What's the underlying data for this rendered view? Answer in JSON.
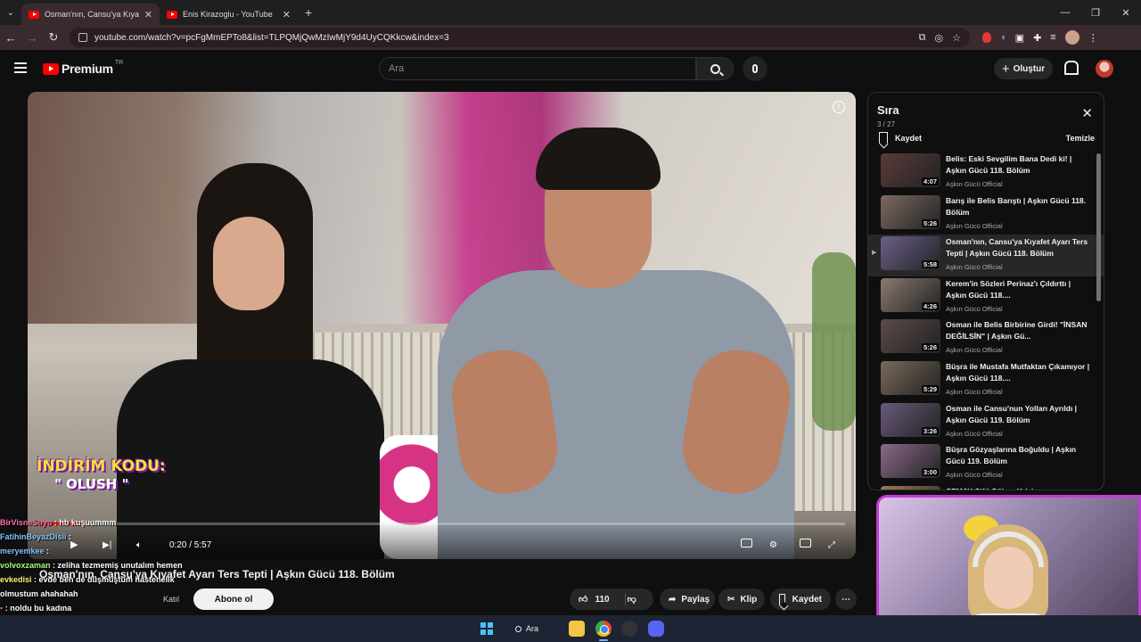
{
  "browser": {
    "tabs": [
      {
        "title": "Osman'nın, Cansu'ya Kıyafet Ay",
        "active": true
      },
      {
        "title": "Enis Kirazoglu - YouTube",
        "active": false
      }
    ],
    "url": "youtube.com/watch?v=pcFgMmEPTo8&list=TLPQMjQwMzIwMjY9d4UyCQKkcw&index=3"
  },
  "youtube": {
    "logo_text": "Premium",
    "logo_country": "TR",
    "search_placeholder": "Ara",
    "create_label": "Oluştur"
  },
  "player": {
    "promo_line1": "İNDİRİM KODU:",
    "promo_line2": "\" OLUSH \"",
    "time": "0:20 / 5:57",
    "progress": 0.056
  },
  "video": {
    "title": "Osman'nın, Cansu'ya Kıyafet Ayarı Ters Tepti | Aşkın Gücü 118. Bölüm",
    "joined": "Katıl",
    "subscribe": "Abone ol",
    "likes": "110",
    "share": "Paylaş",
    "clip": "Klip",
    "save": "Kaydet"
  },
  "chat": [
    {
      "user": "BirVisneSuyu",
      "msg": "hb kuşuummm"
    },
    {
      "user": "FatihinBeyazDisii",
      "msg": ""
    },
    {
      "user": "meryemkee",
      "msg": ""
    },
    {
      "user": "volvoxzaman",
      "msg": "zeliha tezmemiş unutalım hemen"
    },
    {
      "user": "evkedisi",
      "msg": "evde ben de düşmüştüm hastenelik"
    },
    {
      "user": "",
      "msg": "olmustum ahahahah"
    },
    {
      "user": "",
      "msg": "noldu bu kadına"
    }
  ],
  "queue": {
    "title": "Sıra",
    "count": "3 / 27",
    "save": "Kaydet",
    "clear": "Temizle",
    "items": [
      {
        "title": "Belis: Eski Sevgilim Bana Dedi ki! | Aşkın Gücü 118. Bölüm",
        "channel": "Aşkın Gücü Official",
        "duration": "4:07",
        "active": false,
        "index": ""
      },
      {
        "title": "Barış ile Belis Barıştı | Aşkın Gücü 118. Bölüm",
        "channel": "Aşkın Gücü Official",
        "duration": "5:26",
        "active": false,
        "index": ""
      },
      {
        "title": "Osman'nın, Cansu'ya Kıyafet Ayarı Ters Tepti | Aşkın Gücü 118. Bölüm",
        "channel": "Aşkın Gücü Official",
        "duration": "5:58",
        "active": true,
        "index": "▶"
      },
      {
        "title": "Kerem'in Sözleri Perinaz'ı Çıldırttı | Aşkın Gücü 118....",
        "channel": "Aşkın Gücü Official",
        "duration": "4:26",
        "active": false,
        "index": ""
      },
      {
        "title": "Osman ile Belis Birbirine Girdi! \"İNSAN DEĞİLSİN\" | Aşkın Gü...",
        "channel": "Aşkın Gücü Official",
        "duration": "5:26",
        "active": false,
        "index": ""
      },
      {
        "title": "Büşra ile Mustafa Mutfaktan Çıkamıyor | Aşkın Gücü 118....",
        "channel": "Aşkın Gücü Official",
        "duration": "5:29",
        "active": false,
        "index": ""
      },
      {
        "title": "Osman ile Cansu'nun Yolları Ayrıldı | Aşkın Gücü 119. Bölüm",
        "channel": "Aşkın Gücü Official",
        "duration": "3:26",
        "active": false,
        "index": ""
      },
      {
        "title": "Büşra Gözyaşlarına Boğuldu | Aşkın Gücü 119. Bölüm",
        "channel": "Aşkın Gücü Official",
        "duration": "3:00",
        "active": false,
        "index": ""
      },
      {
        "title": "CEMAY Çifti Gülme Krizine...",
        "channel": "",
        "duration": "",
        "active": false,
        "index": ""
      }
    ]
  },
  "taskbar": {
    "search_label": "Ara"
  },
  "colors": {
    "accent": "#ff0000",
    "webcam_border": "#c23bd4",
    "tab_active": "#3a2a2e"
  }
}
